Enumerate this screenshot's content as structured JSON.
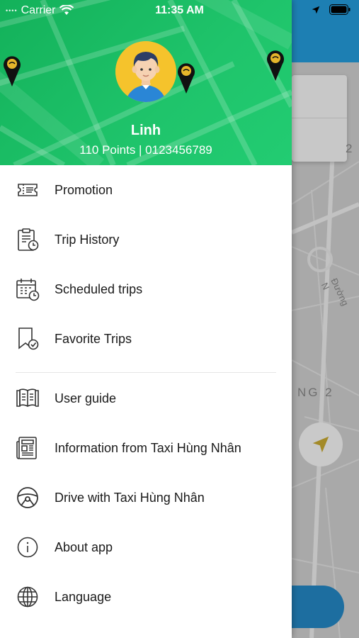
{
  "status_bar": {
    "carrier": "Carrier",
    "time": "11:35 AM"
  },
  "user": {
    "name": "Linh",
    "info": "110 Points | 0123456789"
  },
  "menu": {
    "items": [
      {
        "label": "Promotion",
        "icon": "ticket-icon"
      },
      {
        "label": "Trip History",
        "icon": "clipboard-clock-icon"
      },
      {
        "label": "Scheduled trips",
        "icon": "calendar-clock-icon"
      },
      {
        "label": "Favorite Trips",
        "icon": "bookmark-check-icon"
      },
      {
        "label": "User guide",
        "icon": "book-icon"
      },
      {
        "label": "Information from Taxi Hùng Nhân",
        "icon": "newspaper-icon"
      },
      {
        "label": "Drive with Taxi Hùng Nhân",
        "icon": "steering-wheel-icon"
      },
      {
        "label": "About app",
        "icon": "info-icon"
      },
      {
        "label": "Language",
        "icon": "globe-icon"
      }
    ]
  },
  "background_map": {
    "label_right": "2",
    "district_label": "NG 2",
    "street_label": "Đường N"
  },
  "colors": {
    "header_green": "#1fc46b",
    "avatar_yellow": "#f5c32c",
    "topbar_blue": "#1d7fb3"
  }
}
